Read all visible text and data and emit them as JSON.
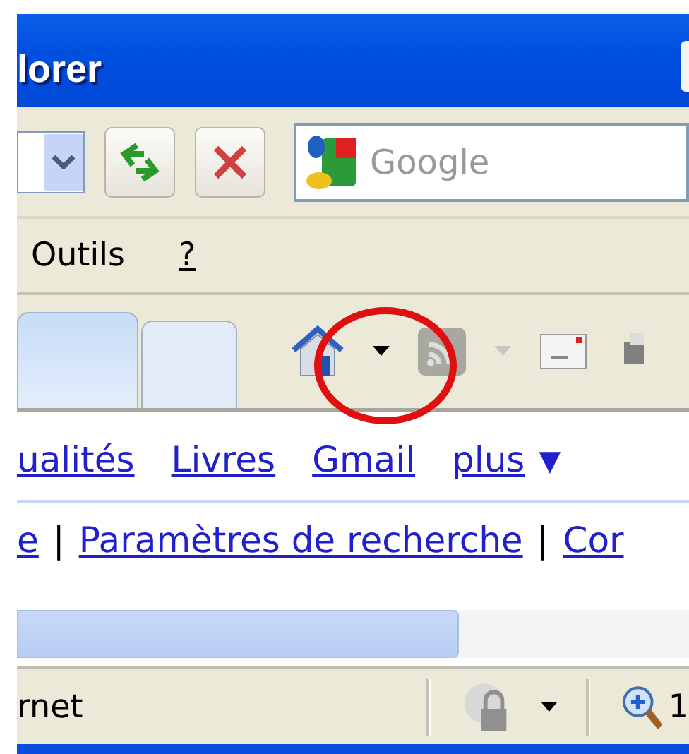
{
  "window": {
    "title": "lorer"
  },
  "address_bar": {
    "search": {
      "placeholder": "Google"
    }
  },
  "menu": [
    {
      "label": "Outils"
    },
    {
      "label": "?"
    }
  ],
  "tabs": [
    {
      "selected": true
    },
    {
      "selected": false
    }
  ],
  "command_bar": {
    "feeds": {
      "disabled": true
    }
  },
  "page": {
    "nav_links": [
      {
        "text": "ualités",
        "kind": "link"
      },
      {
        "text": "Livres",
        "kind": "link"
      },
      {
        "text": "Gmail",
        "kind": "link"
      },
      {
        "text": "plus",
        "kind": "more"
      }
    ],
    "more_arrow": "▼",
    "footer_links": [
      {
        "kind": "link",
        "text": "e"
      },
      {
        "kind": "sep",
        "text": "|"
      },
      {
        "kind": "link",
        "text": "Paramètres de recherche"
      },
      {
        "kind": "sep",
        "text": "|"
      },
      {
        "kind": "link",
        "text": "Cor"
      }
    ]
  },
  "status_bar": {
    "zone": "rnet",
    "zoom": "1"
  }
}
